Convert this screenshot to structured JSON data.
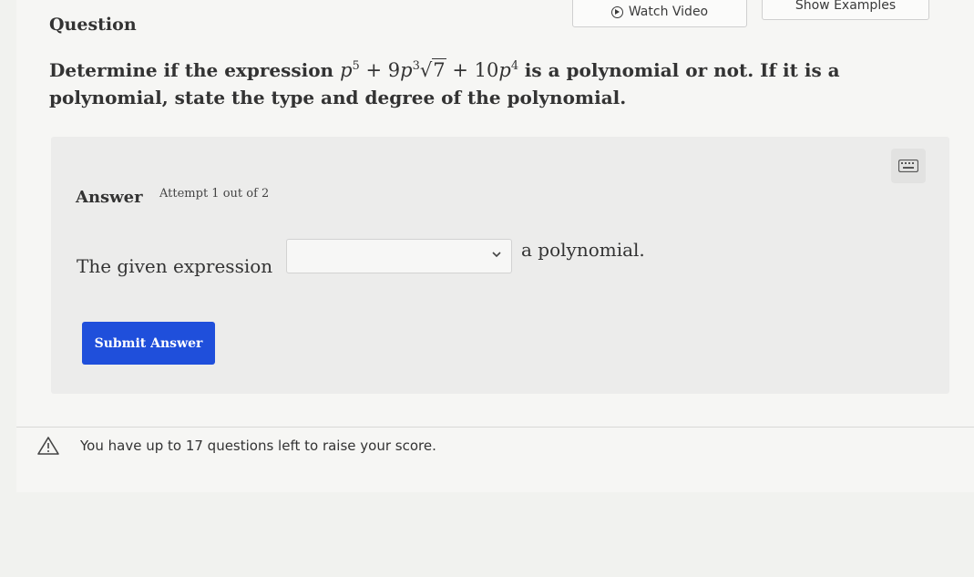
{
  "header": {
    "question_label": "Question",
    "watch_video_label": "Watch Video",
    "show_examples_label": "Show Examples"
  },
  "question": {
    "prefix": "Determine if the expression",
    "expression": {
      "t1_base": "p",
      "t1_exp": "5",
      "plus1": "+",
      "t2_coef": "9",
      "t2_base": "p",
      "t2_exp": "3",
      "radicand": "7",
      "plus2": "+",
      "t3_coef": "10",
      "t3_base": "p",
      "t3_exp": "4"
    },
    "suffix": "is a polynomial or not. If it is a polynomial, state the type and degree of the polynomial."
  },
  "answer": {
    "label": "Answer",
    "attempt": "Attempt 1 out of 2",
    "given_prefix": "The given expression",
    "dropdown_value": "",
    "given_suffix": "a polynomial.",
    "submit_label": "Submit Answer"
  },
  "notice": {
    "text": "You have up to 17 questions left to raise your score."
  },
  "colors": {
    "submit_bg": "#1f4fdb",
    "page_bg": "#f1f2ef"
  },
  "icons": [
    "play-circle-icon",
    "keyboard-icon",
    "chevron-down-icon",
    "warning-icon"
  ]
}
